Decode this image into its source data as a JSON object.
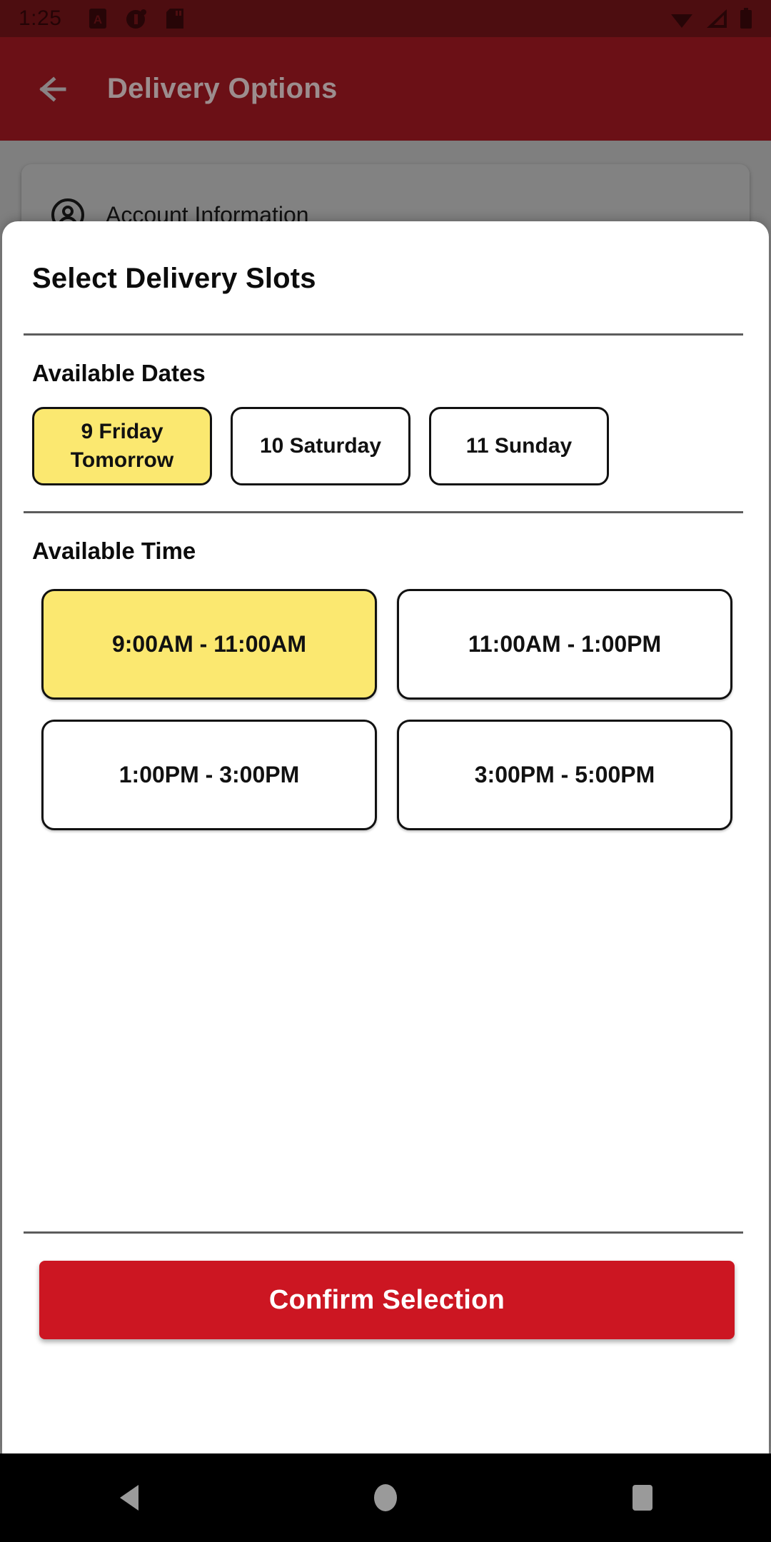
{
  "status_bar": {
    "time": "1:25",
    "left_icons": [
      "a-badge-icon",
      "circle-pin-icon",
      "sd-card-icon"
    ],
    "right_icons": [
      "wifi-icon",
      "cellular-signal-icon",
      "battery-icon"
    ],
    "background_color": "#4d0d10"
  },
  "app_bar": {
    "back_icon": "back-arrow-icon",
    "title": "Delivery Options",
    "background_color": "#6b1016",
    "title_color": "#9c8d8e"
  },
  "background_page": {
    "card": {
      "icon": "account-circle-icon",
      "label": "Account Information"
    },
    "scrim_color": "#7f7f7f"
  },
  "sheet": {
    "title": "Select Delivery Slots",
    "dates_section": {
      "heading": "Available Dates",
      "chips": [
        {
          "line1": "9 Friday",
          "line2": "Tomorrow",
          "selected": true
        },
        {
          "line1": "10 Saturday",
          "line2": "",
          "selected": false
        },
        {
          "line1": "11 Sunday",
          "line2": "",
          "selected": false
        }
      ]
    },
    "time_section": {
      "heading": "Available Time",
      "slots": [
        {
          "label": "9:00AM - 11:00AM",
          "selected": true
        },
        {
          "label": "11:00AM - 1:00PM",
          "selected": false
        },
        {
          "label": "1:00PM - 3:00PM",
          "selected": false
        },
        {
          "label": "3:00PM - 5:00PM",
          "selected": false
        }
      ]
    },
    "confirm_button": {
      "label": "Confirm Selection",
      "color": "#cc1622",
      "text_color": "#ffffff"
    },
    "selected_color": "#fbe870",
    "border_color": "#111111"
  },
  "nav_bar": {
    "buttons": [
      "back-triangle-icon",
      "home-circle-icon",
      "recents-square-icon"
    ],
    "icon_color": "#9a9a9a",
    "background_color": "#000000"
  }
}
